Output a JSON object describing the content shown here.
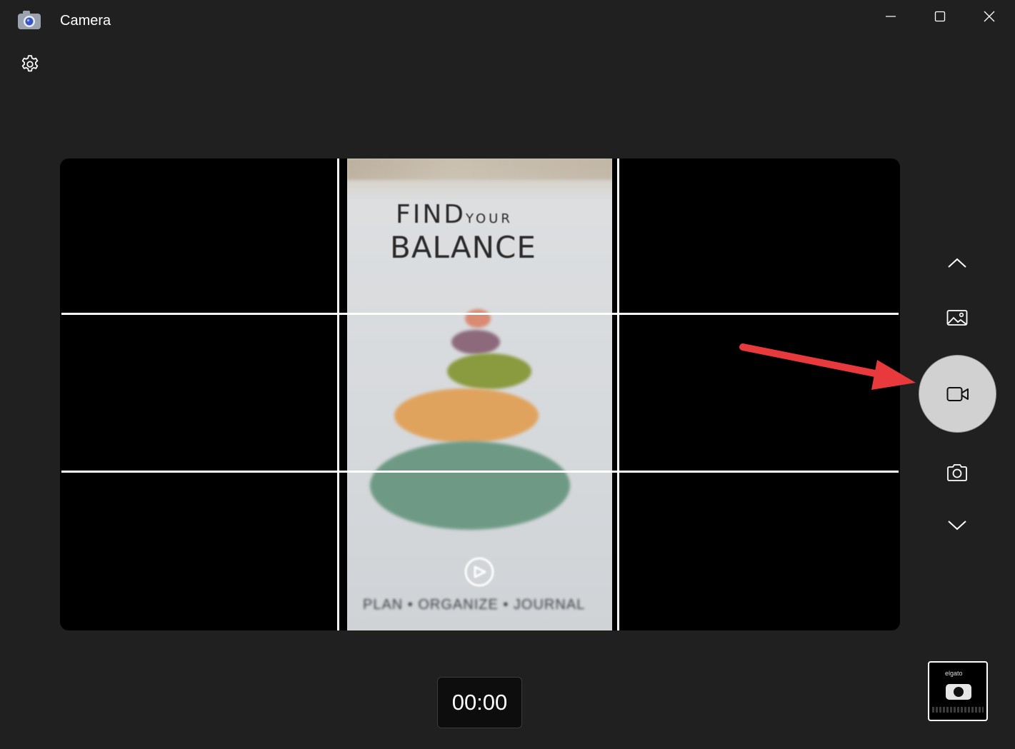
{
  "window": {
    "title": "Camera",
    "controls": {
      "minimize": "minimize-icon",
      "maximize": "maximize-icon",
      "close": "close-icon"
    }
  },
  "toolbar": {
    "settings_icon": "gear-icon"
  },
  "viewfinder": {
    "framing_grid": "rule-of-thirds",
    "feed": {
      "headline_find": "FIND",
      "headline_your": "YOUR",
      "headline_balance": "BALANCE",
      "tagline": "PLAN • ORGANIZE • JOURNAL",
      "stone_colors": [
        "#d98a73",
        "#8c6a7b",
        "#8a9a3f",
        "#e0a35e",
        "#6e9a85"
      ]
    }
  },
  "mode_switcher": {
    "items": [
      {
        "name": "scroll-up",
        "icon": "chevron-up-icon"
      },
      {
        "name": "photo-mode",
        "icon": "landscape-photo-icon"
      },
      {
        "name": "video-mode",
        "icon": "video-camera-icon",
        "selected": true
      },
      {
        "name": "photo-capture",
        "icon": "camera-icon"
      },
      {
        "name": "scroll-down",
        "icon": "chevron-down-icon"
      }
    ]
  },
  "recording": {
    "timer": "00:00"
  },
  "last_capture": {
    "brand_text": "elgato"
  },
  "annotation": {
    "type": "arrow",
    "color": "#e8393c",
    "points_to": "video-mode"
  }
}
